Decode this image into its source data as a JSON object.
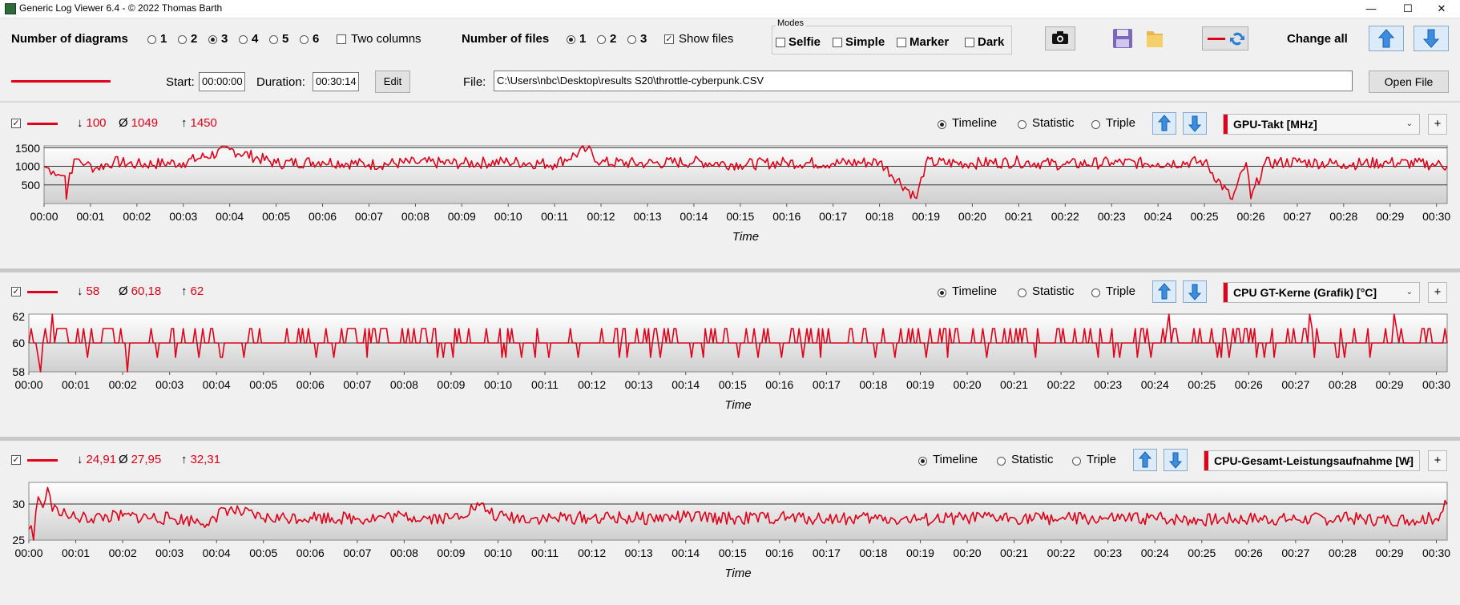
{
  "window": {
    "title": "Generic Log Viewer 6.4 - © 2022 Thomas Barth",
    "minimize_glyph": "—",
    "maximize_glyph": "☐",
    "close_glyph": "✕"
  },
  "toolbar": {
    "diagrams_label": "Number of diagrams",
    "diagram_options": [
      "1",
      "2",
      "3",
      "4",
      "5",
      "6"
    ],
    "diagram_selected": "3",
    "two_columns_label": "Two columns",
    "files_label": "Number of files",
    "file_options": [
      "1",
      "2",
      "3"
    ],
    "file_selected": "1",
    "show_files_label": "Show files",
    "show_files_checked": true,
    "modes_label": "Modes",
    "modes": [
      "Selfie",
      "Simple",
      "Marker",
      "Dark"
    ],
    "change_all_label": "Change all",
    "icons": [
      "camera-icon",
      "save-icon",
      "folder-icon",
      "swap-icon",
      "arrow-up-icon",
      "arrow-down-icon"
    ]
  },
  "file_row": {
    "start_label": "Start:",
    "start_value": "00:00:00",
    "duration_label": "Duration:",
    "duration_value": "00:30:14",
    "edit_label": "Edit",
    "file_label": "File:",
    "file_path": "C:\\Users\\nbc\\Desktop\\results S20\\throttle-cyberpunk.CSV",
    "open_file_label": "Open File",
    "line_color": "#e0001a"
  },
  "view_options": [
    "Timeline",
    "Statistic",
    "Triple"
  ],
  "time_ticks": [
    "00:00",
    "00:01",
    "00:02",
    "00:03",
    "00:04",
    "00:05",
    "00:06",
    "00:07",
    "00:08",
    "00:09",
    "00:10",
    "00:11",
    "00:12",
    "00:13",
    "00:14",
    "00:15",
    "00:16",
    "00:17",
    "00:18",
    "00:19",
    "00:20",
    "00:21",
    "00:22",
    "00:23",
    "00:24",
    "00:25",
    "00:26",
    "00:27",
    "00:28",
    "00:29",
    "00:30"
  ],
  "panels": [
    {
      "min": "100",
      "avg": "1049",
      "max": "1450",
      "selected_view": "Timeline",
      "sensor": "GPU-Takt [MHz]",
      "plus": "+"
    },
    {
      "min": "58",
      "avg": "60,18",
      "max": "62",
      "selected_view": "Timeline",
      "sensor": "CPU GT-Kerne (Grafik) [°C]",
      "plus": "+"
    },
    {
      "min": "24,91",
      "avg": "27,95",
      "max": "32,31",
      "selected_view": "Timeline",
      "sensor": "CPU-Gesamt-Leistungsaufnahme [W]",
      "plus": "+"
    }
  ],
  "stat_symbols": {
    "min": "↓",
    "avg": "Ø",
    "max": "↑"
  },
  "chart_data": [
    {
      "type": "line",
      "xlabel": "Time",
      "ylabel": "",
      "x_range_minutes": [
        0,
        30.23
      ],
      "ylim": [
        0,
        1550
      ],
      "yticks": [
        "500",
        "1000",
        "1500"
      ],
      "ytick_values": [
        500,
        1000,
        1500
      ],
      "grid": "horizontal lines at 500 and 1000",
      "series": [
        {
          "color": "#e0001a",
          "points": [
            [
              0,
              1000
            ],
            [
              0.2,
              870
            ],
            [
              0.35,
              760
            ],
            [
              0.45,
              740
            ],
            [
              0.48,
              120
            ],
            [
              0.55,
              820
            ],
            [
              0.7,
              1200
            ],
            [
              0.9,
              1060
            ],
            [
              1.1,
              950
            ],
            [
              1.5,
              1120
            ],
            [
              2,
              1050
            ],
            [
              3,
              1100
            ],
            [
              4,
              1450
            ],
            [
              5,
              1080
            ],
            [
              6,
              1130
            ],
            [
              7,
              1050
            ],
            [
              8,
              1100
            ],
            [
              9,
              1080
            ],
            [
              10,
              1120
            ],
            [
              11,
              1060
            ],
            [
              11.7,
              1460
            ],
            [
              12,
              1100
            ],
            [
              13,
              1080
            ],
            [
              14,
              1120
            ],
            [
              15,
              1050
            ],
            [
              16,
              1100
            ],
            [
              17,
              1080
            ],
            [
              18,
              1120
            ],
            [
              18.8,
              140
            ],
            [
              19,
              1100
            ],
            [
              20,
              1080
            ],
            [
              21,
              1120
            ],
            [
              22,
              1050
            ],
            [
              23,
              1100
            ],
            [
              24,
              1080
            ],
            [
              25,
              1120
            ],
            [
              25.6,
              110
            ],
            [
              25.9,
              1100
            ],
            [
              26,
              130
            ],
            [
              26.3,
              1080
            ],
            [
              27,
              1120
            ],
            [
              28,
              1060
            ],
            [
              29,
              1100
            ],
            [
              30,
              1050
            ],
            [
              30.23,
              1000
            ]
          ]
        }
      ]
    },
    {
      "type": "line",
      "xlabel": "Time",
      "ylabel": "",
      "x_range_minutes": [
        0,
        30.23
      ],
      "ylim": [
        58,
        62
      ],
      "yticks": [
        "58",
        "60",
        "62"
      ],
      "ytick_values": [
        58,
        60,
        62
      ],
      "grid": "horizontal lines at 60 and 62",
      "series": [
        {
          "color": "#e0001a",
          "points": [
            [
              0,
              60
            ],
            [
              0.2,
              59
            ],
            [
              0.25,
              58
            ],
            [
              0.3,
              60
            ],
            [
              0.5,
              62
            ],
            [
              0.6,
              61
            ],
            [
              0.8,
              61
            ],
            [
              0.9,
              60
            ],
            [
              1,
              60
            ],
            [
              2,
              60
            ],
            [
              2.1,
              58
            ],
            [
              2.3,
              60
            ],
            [
              3,
              60
            ],
            [
              4,
              60
            ],
            [
              5,
              60
            ],
            [
              6,
              60
            ],
            [
              7,
              60
            ],
            [
              8,
              60
            ],
            [
              9,
              60
            ],
            [
              10,
              60
            ],
            [
              11,
              60
            ],
            [
              12,
              60
            ],
            [
              13,
              60
            ],
            [
              14,
              60
            ],
            [
              15,
              60
            ],
            [
              16,
              60
            ],
            [
              17,
              60
            ],
            [
              18,
              60
            ],
            [
              19,
              60
            ],
            [
              20,
              60
            ],
            [
              21,
              60
            ],
            [
              22,
              60
            ],
            [
              23,
              60
            ],
            [
              24,
              60
            ],
            [
              24.3,
              62
            ],
            [
              24.5,
              60
            ],
            [
              25,
              60
            ],
            [
              26,
              60
            ],
            [
              27,
              60
            ],
            [
              27.3,
              62
            ],
            [
              27.5,
              60
            ],
            [
              28,
              60
            ],
            [
              29,
              60
            ],
            [
              29.1,
              62
            ],
            [
              29.3,
              60
            ],
            [
              30,
              60
            ],
            [
              30.23,
              60
            ]
          ]
        }
      ]
    },
    {
      "type": "line",
      "xlabel": "Time",
      "ylabel": "",
      "x_range_minutes": [
        0,
        30.23
      ],
      "ylim": [
        25,
        33
      ],
      "yticks": [
        "25",
        "30"
      ],
      "ytick_values": [
        25,
        30
      ],
      "grid": "horizontal line at 30",
      "series": [
        {
          "color": "#e0001a",
          "points": [
            [
              0,
              26.5
            ],
            [
              0.05,
              27
            ],
            [
              0.1,
              25
            ],
            [
              0.15,
              29
            ],
            [
              0.2,
              31
            ],
            [
              0.3,
              29.5
            ],
            [
              0.4,
              32.3
            ],
            [
              0.5,
              29
            ],
            [
              0.6,
              29.5
            ],
            [
              0.8,
              28.5
            ],
            [
              1,
              28
            ],
            [
              2,
              28.3
            ],
            [
              3,
              28
            ],
            [
              4,
              27.5
            ],
            [
              4.1,
              29.5
            ],
            [
              5,
              28
            ],
            [
              6,
              28.2
            ],
            [
              7,
              28
            ],
            [
              8,
              28.3
            ],
            [
              9,
              28
            ],
            [
              9.6,
              29.8
            ],
            [
              10,
              28.2
            ],
            [
              11,
              28
            ],
            [
              12,
              28.1
            ],
            [
              13,
              28
            ],
            [
              14,
              28.2
            ],
            [
              15,
              28
            ],
            [
              16,
              28.1
            ],
            [
              17,
              28
            ],
            [
              18,
              28
            ],
            [
              19,
              27.8
            ],
            [
              20,
              28
            ],
            [
              21,
              28.1
            ],
            [
              22,
              28
            ],
            [
              23,
              27.9
            ],
            [
              24,
              28
            ],
            [
              25,
              27.8
            ],
            [
              26,
              28
            ],
            [
              27,
              27.9
            ],
            [
              28,
              28
            ],
            [
              29,
              27.8
            ],
            [
              30,
              28
            ],
            [
              30.23,
              30
            ]
          ]
        }
      ]
    }
  ]
}
